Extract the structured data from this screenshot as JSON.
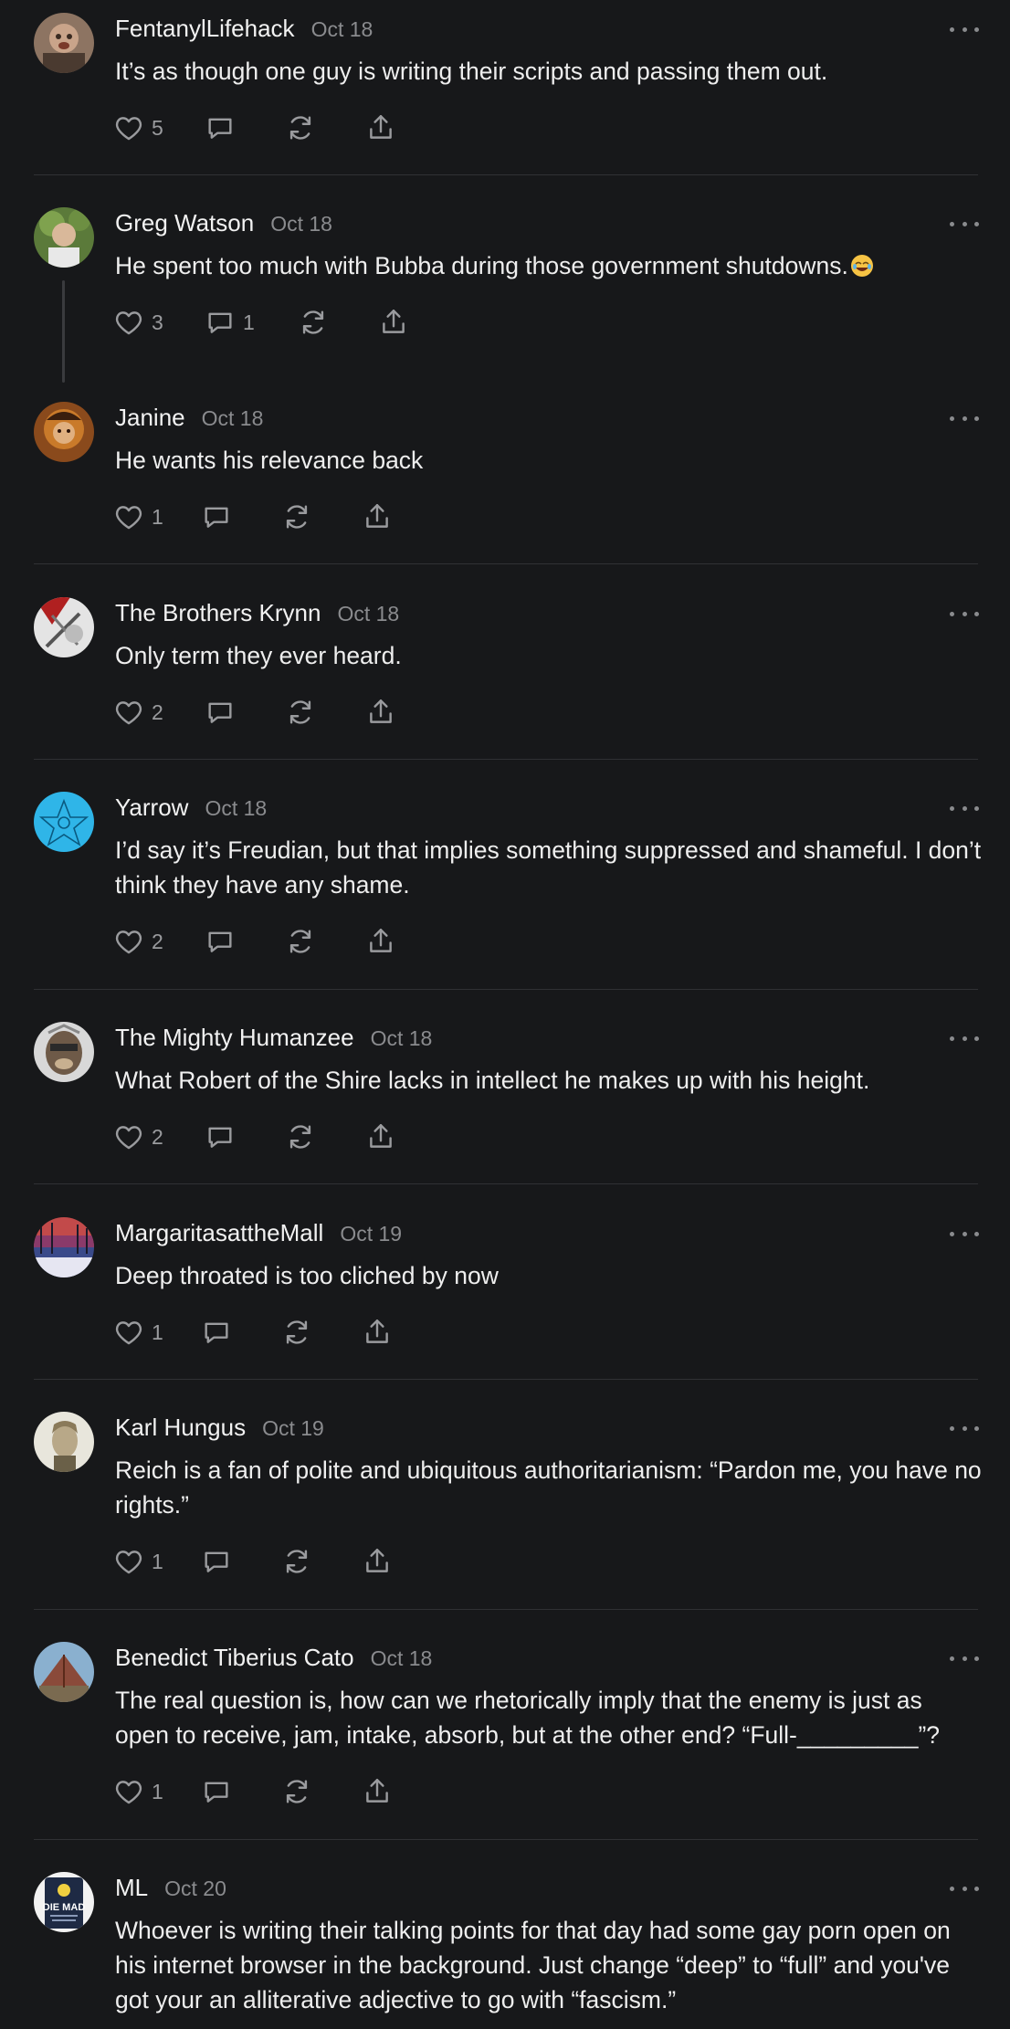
{
  "comments": [
    {
      "author": "FentanylLifehack",
      "date": "Oct 18",
      "text": "It’s as though one guy is writing their scripts and passing them out.",
      "likes": "5",
      "replies": ""
    },
    {
      "author": "Greg Watson",
      "date": "Oct 18",
      "text": "He spent too much with Bubba during those government shutdowns.",
      "likes": "3",
      "replies": "1",
      "emoji": "rolling-on-floor-laughing-emoji"
    },
    {
      "author": "Janine",
      "date": "Oct 18",
      "text": "He wants his relevance back",
      "likes": "1",
      "replies": ""
    },
    {
      "author": "The Brothers Krynn",
      "date": "Oct 18",
      "text": "Only term they ever heard.",
      "likes": "2",
      "replies": ""
    },
    {
      "author": "Yarrow",
      "date": "Oct 18",
      "text": "I’d say it’s Freudian, but that implies something suppressed and shameful. I don’t think they have any shame.",
      "likes": "2",
      "replies": ""
    },
    {
      "author": "The Mighty Humanzee",
      "date": "Oct 18",
      "text": "What Robert of the Shire lacks in intellect he makes up with his height.",
      "likes": "2",
      "replies": ""
    },
    {
      "author": "MargaritasattheMall",
      "date": "Oct 19",
      "text": "Deep throated is too cliched by now",
      "likes": "1",
      "replies": ""
    },
    {
      "author": "Karl Hungus",
      "date": "Oct 19",
      "text": "Reich is a fan of polite and ubiquitous authoritarianism: “Pardon me, you have no rights.”",
      "likes": "1",
      "replies": ""
    },
    {
      "author": "Benedict Tiberius Cato",
      "date": "Oct 18",
      "text": "The real question is, how can we rhetorically imply that the enemy is just as open to receive, jam, intake, absorb, but at the other end? “Full-_________”?",
      "likes": "1",
      "replies": ""
    },
    {
      "author": "ML",
      "date": "Oct 20",
      "text": "Whoever is writing their talking points for that day had some gay porn open on his internet browser in the background. Just change “deep” to “full” and you've got your an alliterative adjective to go with “fascism.”",
      "likes": "",
      "replies": "",
      "avatar_text": "DIE MAD"
    }
  ],
  "icons": {
    "like": "heart-icon",
    "reply": "comment-bubble-icon",
    "restack": "restack-arrows-icon",
    "share": "share-upload-icon",
    "more": "more-dots-icon"
  },
  "colors": {
    "background": "#17181a",
    "text": "#eeeeee",
    "muted": "#8a8b8e",
    "divider": "#303134"
  }
}
